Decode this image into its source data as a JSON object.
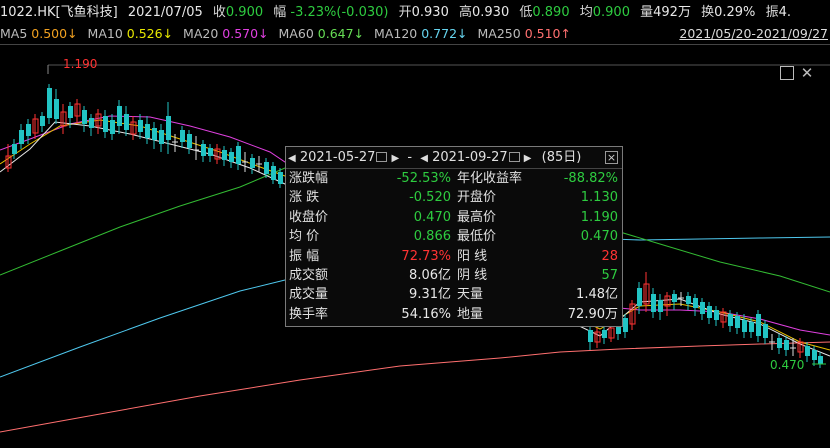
{
  "quote": {
    "symbol": "1022.HK[飞鱼科技]",
    "date": "2021/07/05",
    "close_label": "收",
    "close": "0.900",
    "change_label": "幅",
    "change": "-3.23%(-0.030)",
    "open_label": "开",
    "open": "0.930",
    "high_label": "高",
    "high": "0.930",
    "low_label": "低",
    "low": "0.890",
    "avg_label": "均",
    "avg": "0.900",
    "volume_label": "量",
    "volume": "492万",
    "turnover_label": "换",
    "turnover": "0.29%",
    "amplitude_label": "振",
    "amplitude": "4."
  },
  "ma": [
    {
      "label": "MA5",
      "value": "0.500",
      "arrow": "↓"
    },
    {
      "label": "MA10",
      "value": "0.526",
      "arrow": "↓"
    },
    {
      "label": "MA20",
      "value": "0.570",
      "arrow": "↓"
    },
    {
      "label": "MA60",
      "value": "0.647",
      "arrow": "↓"
    },
    {
      "label": "MA120",
      "value": "0.772",
      "arrow": "↓"
    },
    {
      "label": "MA250",
      "value": "0.510",
      "arrow": "↑"
    }
  ],
  "range_text": "2021/05/20-2021/09/27",
  "chart": {
    "high_marker": "1.190",
    "low_marker": "0.470",
    "colors": {
      "up": "#ff3333",
      "down": "#22c4c4",
      "ma5": "#e8e8e8",
      "ma10": "#e8c000",
      "ma20": "#e040e0",
      "ma60": "#33bb33",
      "ma120": "#55ccee",
      "ma250": "#ff7070"
    }
  },
  "panel": {
    "start_date": "2021-05-27",
    "sep": "-",
    "end_date": "2021-09-27",
    "days": "(85日)",
    "rows": [
      {
        "k1": "涨跌幅",
        "v1": "-52.53%",
        "c1": "green",
        "k2": "年化收益率",
        "v2": "-88.82%",
        "c2": "green"
      },
      {
        "k1": "涨  跌",
        "v1": "-0.520",
        "c1": "green",
        "k2": "开盘价",
        "v2": "1.130",
        "c2": "green"
      },
      {
        "k1": "收盘价",
        "v1": "0.470",
        "c1": "green",
        "k2": "最高价",
        "v2": "1.190",
        "c2": "green"
      },
      {
        "k1": "均  价",
        "v1": "0.866",
        "c1": "green",
        "k2": "最低价",
        "v2": "0.470",
        "c2": "green"
      },
      {
        "k1": "振  幅",
        "v1": "72.73%",
        "c1": "red",
        "k2": "阳  线",
        "v2": "28",
        "c2": "red"
      },
      {
        "k1": "成交额",
        "v1": "8.06亿",
        "c1": "white",
        "k2": "阴  线",
        "v2": "57",
        "c2": "green"
      },
      {
        "k1": "成交量",
        "v1": "9.31亿",
        "c1": "white",
        "k2": "天量",
        "v2": "1.48亿",
        "c2": "white"
      },
      {
        "k1": "换手率",
        "v1": "54.16%",
        "c1": "white",
        "k2": "地量",
        "v2": "72.90万",
        "c2": "white"
      }
    ]
  }
}
